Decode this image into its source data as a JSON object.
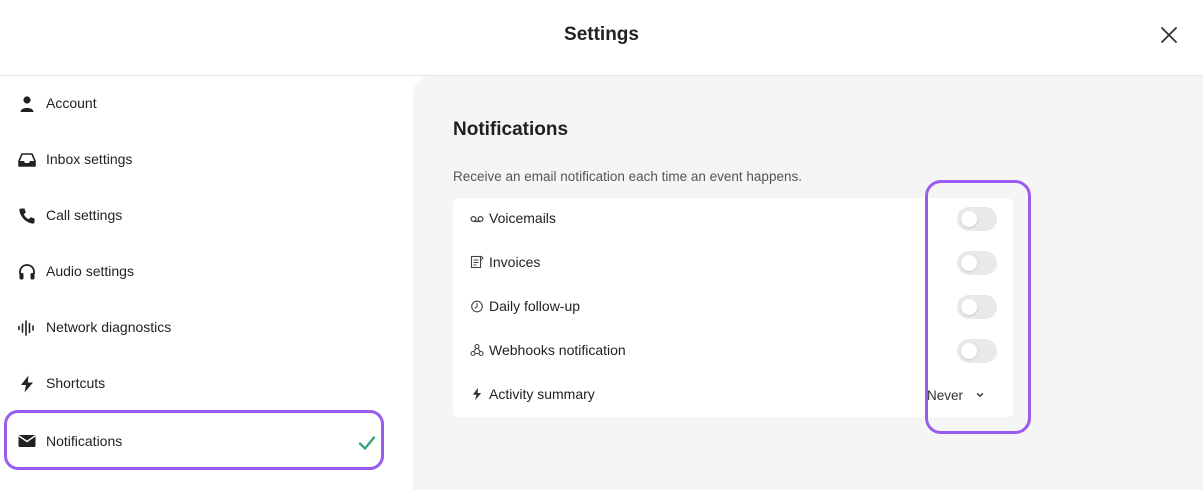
{
  "header": {
    "title": "Settings"
  },
  "sidebar": {
    "items": [
      {
        "label": "Account",
        "icon": "person-icon"
      },
      {
        "label": "Inbox settings",
        "icon": "inbox-tray-icon"
      },
      {
        "label": "Call settings",
        "icon": "phone-icon"
      },
      {
        "label": "Audio settings",
        "icon": "headphones-icon"
      },
      {
        "label": "Network diagnostics",
        "icon": "waveform-icon"
      },
      {
        "label": "Shortcuts",
        "icon": "lightning-icon"
      },
      {
        "label": "Notifications",
        "icon": "envelope-icon",
        "active": true
      }
    ]
  },
  "main": {
    "title": "Notifications",
    "description": "Receive an email notification each time an event happens.",
    "rows": [
      {
        "label": "Voicemails",
        "icon": "voicemail-icon",
        "control": "toggle",
        "enabled": false
      },
      {
        "label": "Invoices",
        "icon": "invoice-icon",
        "control": "toggle",
        "enabled": false
      },
      {
        "label": "Daily follow-up",
        "icon": "clock-icon",
        "control": "toggle",
        "enabled": false
      },
      {
        "label": "Webhooks notification",
        "icon": "webhook-icon",
        "control": "toggle",
        "enabled": false
      },
      {
        "label": "Activity summary",
        "icon": "lightning-icon",
        "control": "select",
        "value": "Never"
      }
    ]
  },
  "colors": {
    "accent": "#9a5cf0",
    "check": "#3aa57a",
    "panel_bg": "#f5f5f5",
    "toggle_off": "#e9e9e9"
  }
}
